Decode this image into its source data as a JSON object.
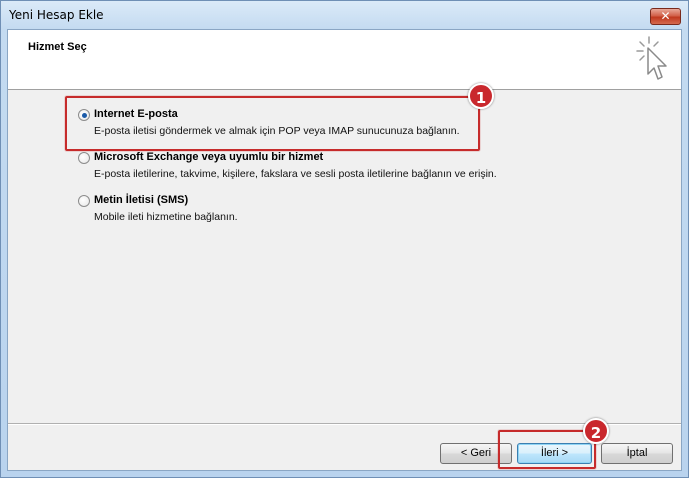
{
  "window": {
    "title": "Yeni Hesap Ekle",
    "close_label": "✕"
  },
  "header": {
    "title": "Hizmet Seç"
  },
  "options": [
    {
      "label": "Internet E-posta",
      "description": "E-posta iletisi göndermek ve almak için POP veya IMAP sunucunuza bağlanın.",
      "selected": true
    },
    {
      "label": "Microsoft Exchange veya uyumlu bir hizmet",
      "description": "E-posta iletilerine, takvime, kişilere, fakslara ve sesli posta iletilerine bağlanın ve erişin.",
      "selected": false
    },
    {
      "label": "Metin İletisi (SMS)",
      "description": "Mobile ileti hizmetine bağlanın.",
      "selected": false
    }
  ],
  "annotations": {
    "badge1": "1",
    "badge2": "2",
    "color": "#c62b2b"
  },
  "buttons": {
    "back": "< Geri",
    "next": "İleri >",
    "cancel": "İptal"
  }
}
